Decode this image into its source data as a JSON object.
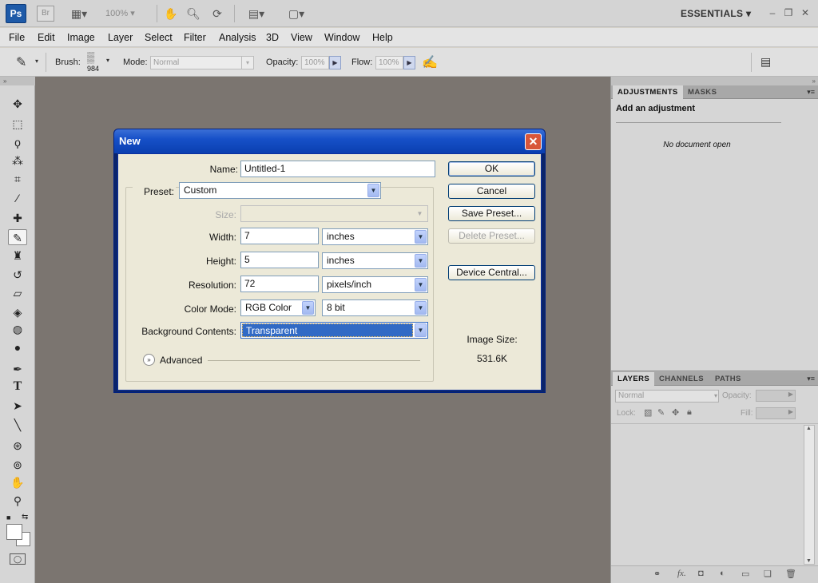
{
  "app": {
    "ps_logo": "Ps",
    "br_logo": "Br",
    "zoom": "100%",
    "workspace": "ESSENTIALS",
    "icons": [
      "screen-mode-icon",
      "hand-icon",
      "zoom-icon",
      "rotate-icon",
      "arrange-icon",
      "screen-icon",
      "minimize-icon",
      "restore-icon",
      "close-icon"
    ]
  },
  "menu": [
    "File",
    "Edit",
    "Image",
    "Layer",
    "Select",
    "Filter",
    "Analysis",
    "3D",
    "View",
    "Window",
    "Help"
  ],
  "options": {
    "brush_label": "Brush:",
    "brush_size": "984",
    "mode_label": "Mode:",
    "mode_value": "Normal",
    "opacity_label": "Opacity:",
    "opacity_value": "100%",
    "flow_label": "Flow:",
    "flow_value": "100%"
  },
  "dialog": {
    "title": "New",
    "name_label": "Name:",
    "name_value": "Untitled-1",
    "preset_label": "Preset:",
    "preset_value": "Custom",
    "size_label": "Size:",
    "width_label": "Width:",
    "width_value": "7",
    "width_unit": "inches",
    "height_label": "Height:",
    "height_value": "5",
    "height_unit": "inches",
    "resolution_label": "Resolution:",
    "resolution_value": "72",
    "resolution_unit": "pixels/inch",
    "colormode_label": "Color Mode:",
    "colormode_value": "RGB Color",
    "bitdepth_value": "8 bit",
    "background_label": "Background Contents:",
    "background_value": "Transparent",
    "advanced_label": "Advanced",
    "buttons": {
      "ok": "OK",
      "cancel": "Cancel",
      "save_preset": "Save Preset...",
      "delete_preset": "Delete Preset...",
      "device_central": "Device Central..."
    },
    "image_size_label": "Image Size:",
    "image_size_value": "531.6K"
  },
  "adjustments_panel": {
    "tabs": [
      "ADJUSTMENTS",
      "MASKS"
    ],
    "heading": "Add an adjustment",
    "message": "No document open"
  },
  "layers_panel": {
    "tabs": [
      "LAYERS",
      "CHANNELS",
      "PATHS"
    ],
    "blend_mode": "Normal",
    "opacity_label": "Opacity:",
    "lock_label": "Lock:",
    "fill_label": "Fill:",
    "fx_label": "fx."
  }
}
